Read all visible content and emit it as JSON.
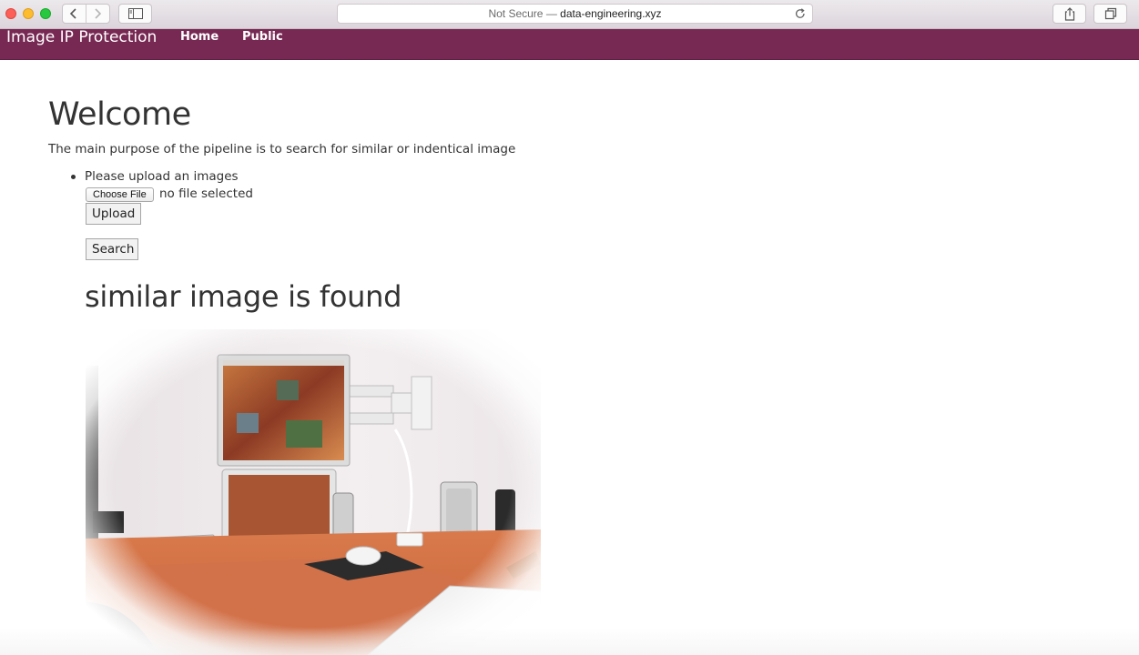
{
  "browser": {
    "url_security": "Not Secure",
    "url_separator": "—",
    "url_domain": "data-engineering.xyz"
  },
  "navbar": {
    "brand": "Image IP Protection",
    "links": [
      "Home",
      "Public"
    ]
  },
  "main": {
    "heading": "Welcome",
    "intro": "The main purpose of the pipeline is to search for similar or indentical image",
    "upload_label": "Please upload an images",
    "choose_file_label": "Choose File",
    "file_status": "no file selected",
    "upload_button": "Upload",
    "search_button": "Search",
    "result_heading": "similar image is found"
  },
  "colors": {
    "navbar_bg": "#772953",
    "text": "#333333"
  }
}
